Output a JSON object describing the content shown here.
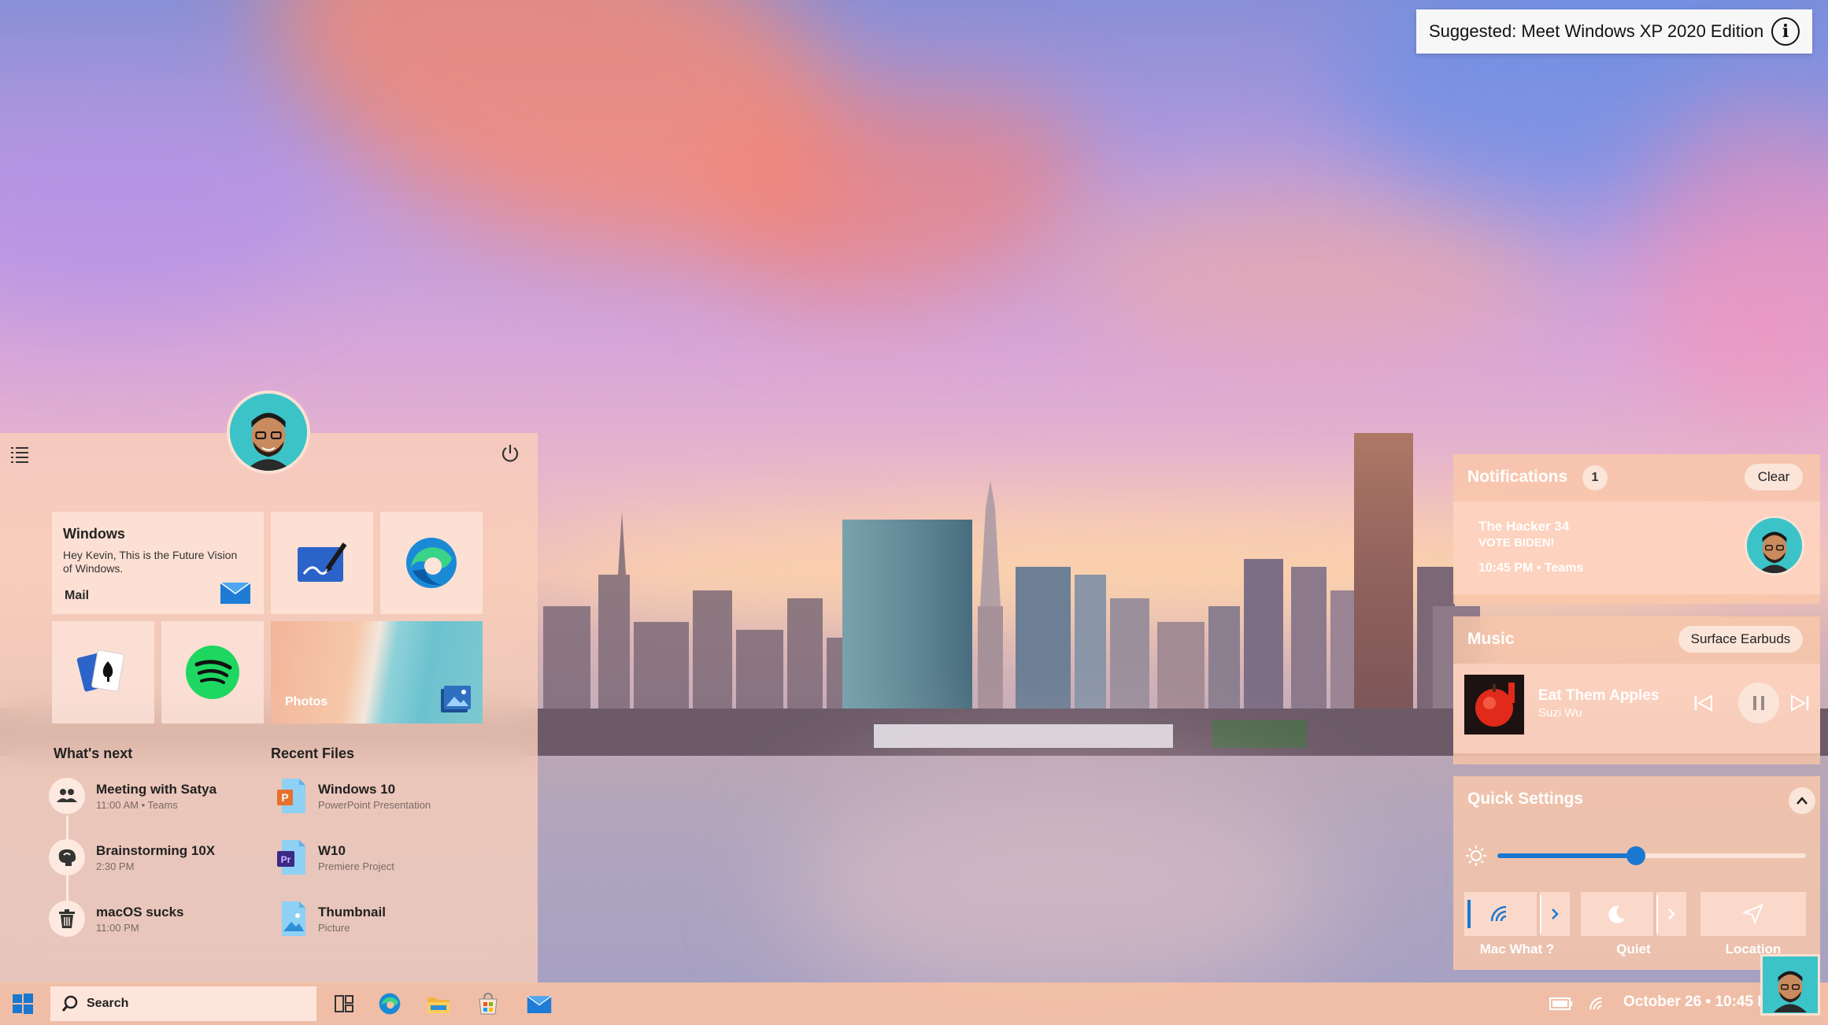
{
  "suggestion": {
    "text": "Suggested: Meet Windows XP 2020 Edition"
  },
  "start_menu": {
    "mail_tile": {
      "title": "Windows",
      "body": "Hey Kevin, This is the Future Vision of Windows.",
      "app": "Mail"
    },
    "photos_tile": {
      "label": "Photos"
    },
    "whats_next": {
      "title": "What's next",
      "items": [
        {
          "title": "Meeting with Satya",
          "sub": "11:00 AM • Teams",
          "icon": "people-icon"
        },
        {
          "title": "Brainstorming 10X",
          "sub": "2:30 PM",
          "icon": "brain-icon"
        },
        {
          "title": "macOS sucks",
          "sub": "11:00 PM",
          "icon": "trash-icon"
        }
      ]
    },
    "recent_files": {
      "title": "Recent Files",
      "items": [
        {
          "title": "Windows 10",
          "sub": "PowerPoint Presentation",
          "icon": "powerpoint-file-icon"
        },
        {
          "title": "W10",
          "sub": "Premiere Project",
          "icon": "premiere-file-icon"
        },
        {
          "title": "Thumbnail",
          "sub": "Picture",
          "icon": "picture-file-icon"
        }
      ]
    }
  },
  "notifications": {
    "title": "Notifications",
    "count": "1",
    "clear_label": "Clear",
    "card": {
      "from": "The Hacker 34",
      "message": "VOTE BIDEN!",
      "time": "10:45 PM • Teams"
    }
  },
  "music": {
    "title": "Music",
    "device": "Surface Earbuds",
    "song": "Eat Them Apples",
    "artist": "Suzi Wu"
  },
  "quick_settings": {
    "title": "Quick Settings",
    "brightness": 0.45,
    "buttons": [
      {
        "label": "Mac What ?",
        "icon": "wifi-icon"
      },
      {
        "label": "Quiet",
        "icon": "moon-icon"
      },
      {
        "label": "Location",
        "icon": "location-icon"
      }
    ]
  },
  "taskbar": {
    "search_placeholder": "Search",
    "datetime": "October 26 • 10:45 PM"
  },
  "colors": {
    "accent": "#1b78d0",
    "panel": "#fac8aa",
    "avatar_bg": "#3bc3c8"
  }
}
